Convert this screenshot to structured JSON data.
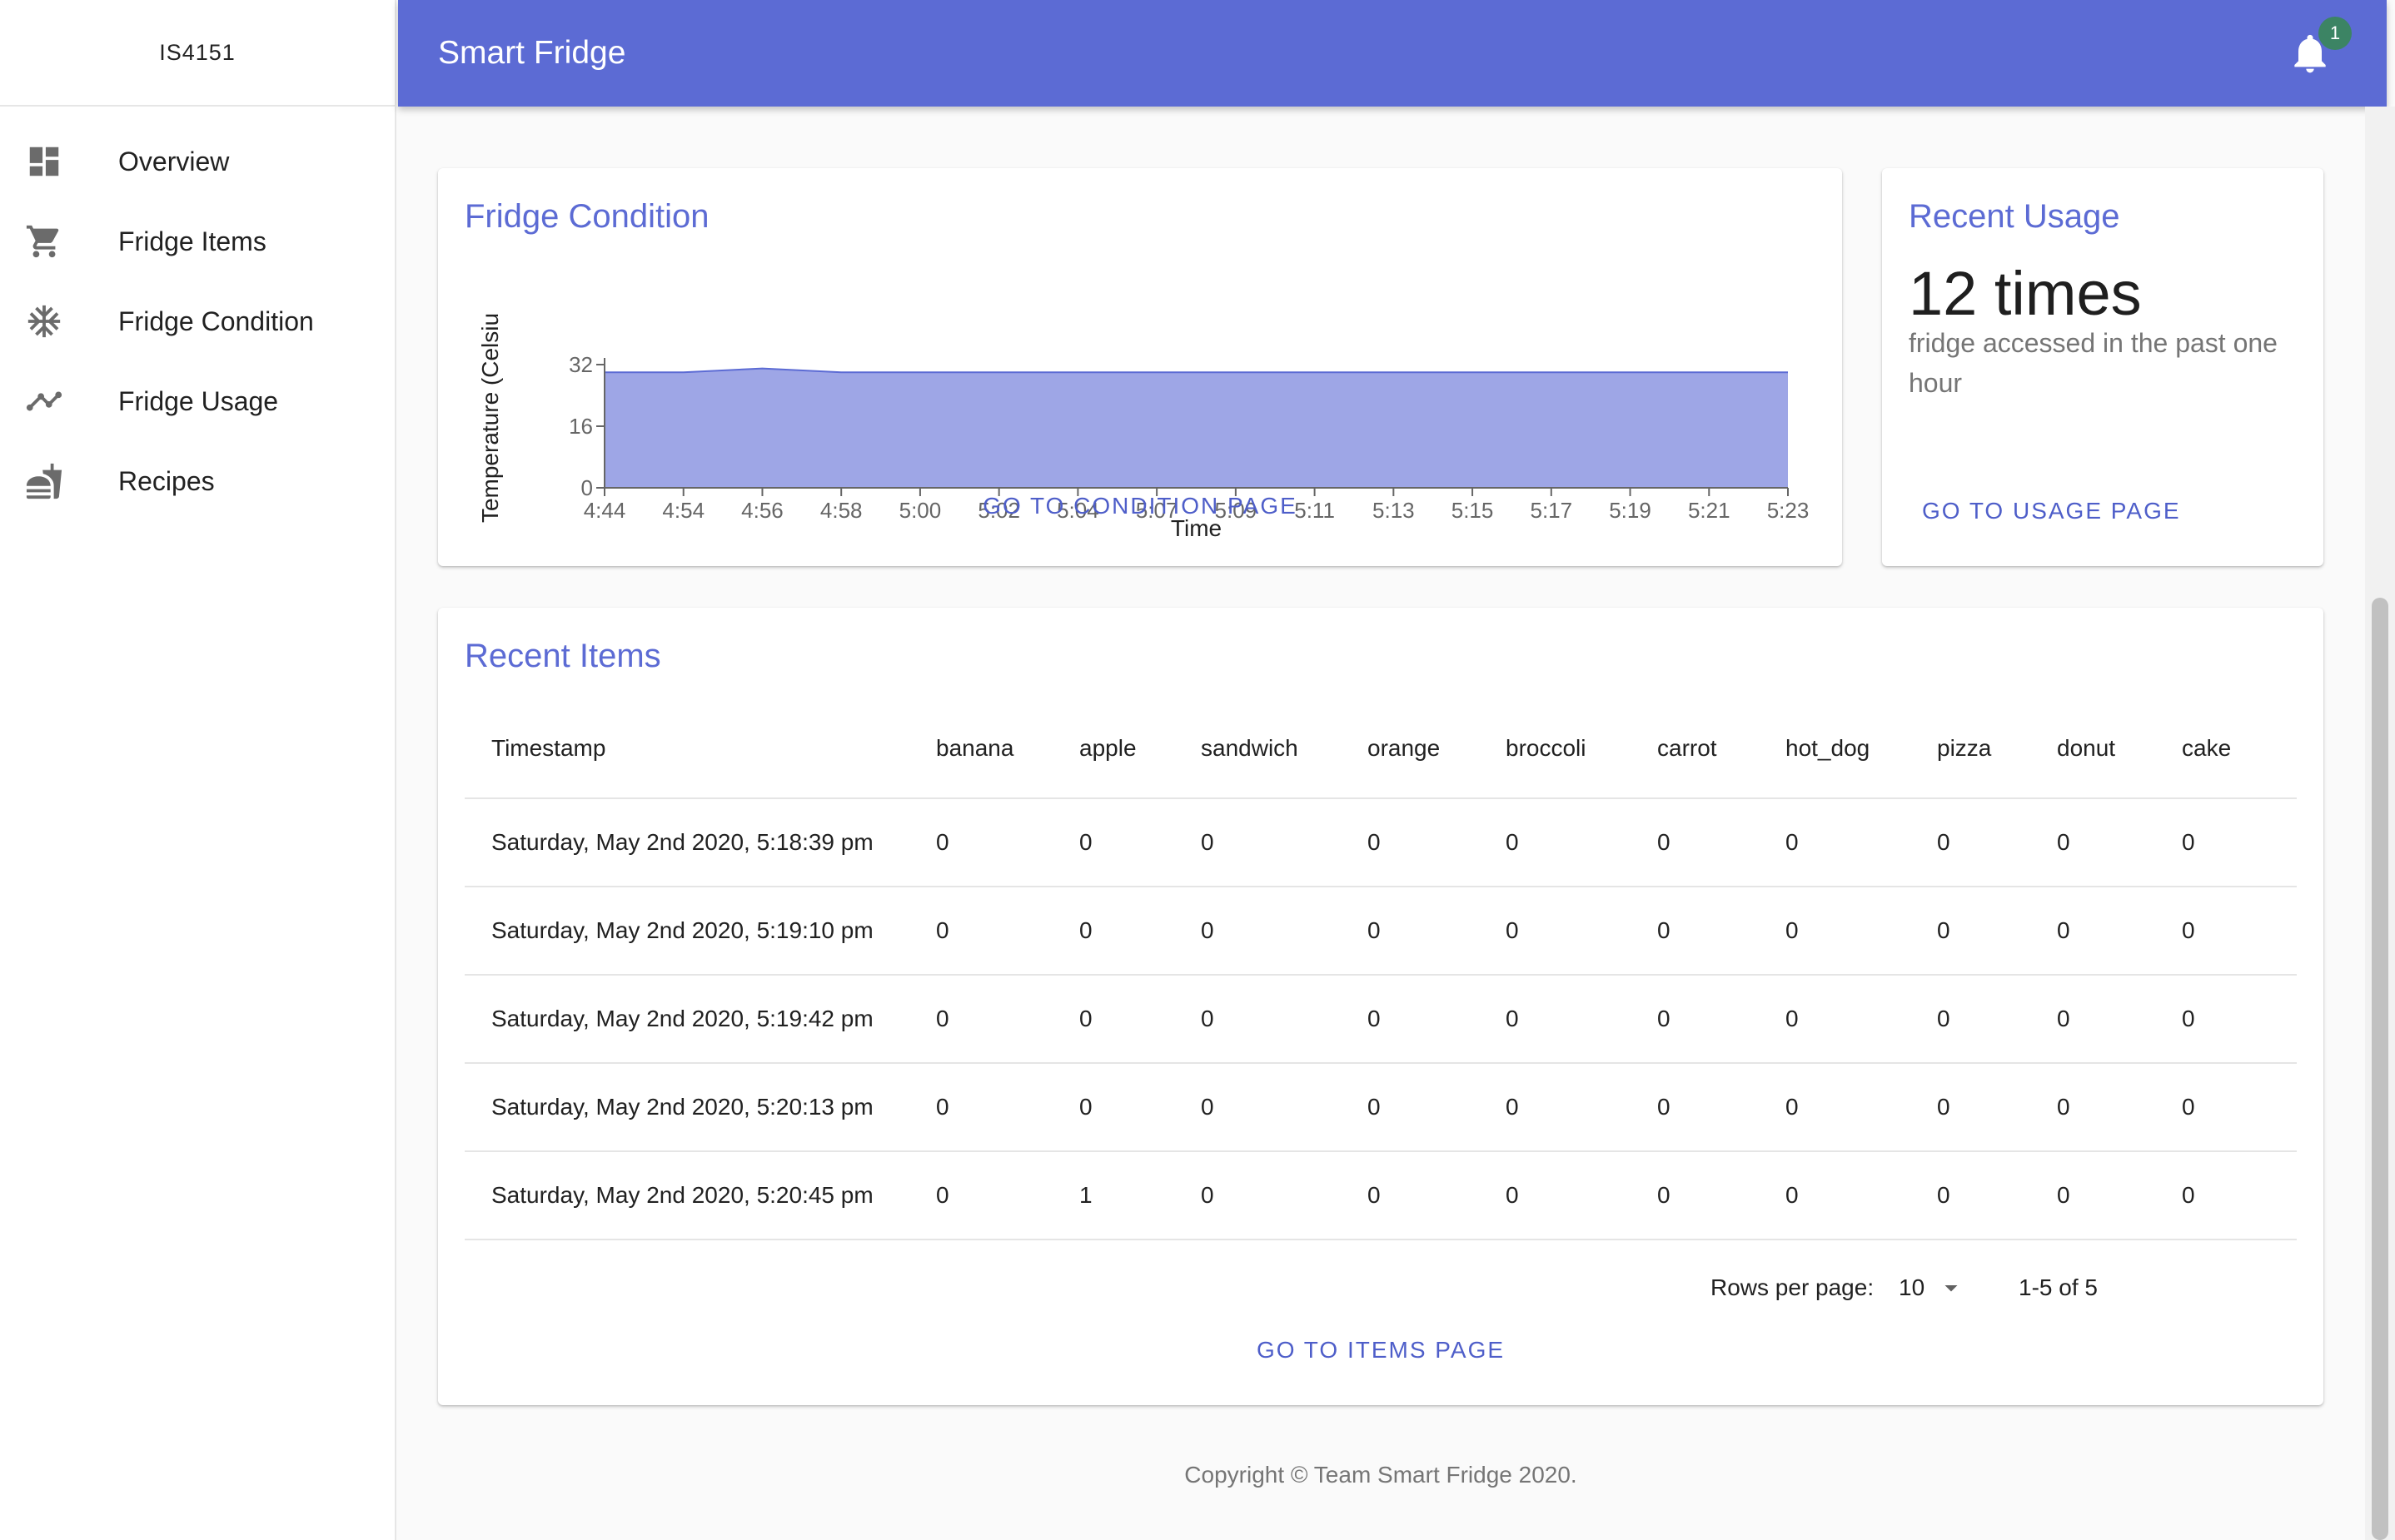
{
  "sidebar": {
    "brand": "IS4151",
    "items": [
      {
        "label": "Overview",
        "icon": "dashboard-icon"
      },
      {
        "label": "Fridge Items",
        "icon": "cart-icon"
      },
      {
        "label": "Fridge Condition",
        "icon": "snowflake-icon"
      },
      {
        "label": "Fridge Usage",
        "icon": "trending-icon"
      },
      {
        "label": "Recipes",
        "icon": "food-icon"
      }
    ]
  },
  "appbar": {
    "title": "Smart Fridge",
    "notification_count": "1"
  },
  "condition_card": {
    "title": "Fridge Condition",
    "link": "GO TO CONDITION PAGE"
  },
  "chart_data": {
    "type": "area",
    "xlabel": "Time",
    "ylabel": "Temperature (Celsiu",
    "ylim": [
      0,
      32
    ],
    "yticks": [
      "0",
      "16",
      "32"
    ],
    "x": [
      "4:44",
      "4:54",
      "4:56",
      "4:58",
      "5:00",
      "5:02",
      "5:04",
      "5:07",
      "5:09",
      "5:11",
      "5:13",
      "5:15",
      "5:17",
      "5:19",
      "5:21",
      "5:23"
    ],
    "series": [
      {
        "values": [
          30,
          30,
          31,
          30,
          30,
          30,
          30,
          30,
          30,
          30,
          30,
          30,
          30,
          30,
          30,
          30
        ]
      }
    ],
    "fill_color": "#9ea6e6",
    "line_color": "#5c6bd4"
  },
  "usage_card": {
    "title": "Recent Usage",
    "count_text": "12 times",
    "description": "fridge accessed in the past one hour",
    "link": "GO TO USAGE PAGE"
  },
  "items_card": {
    "title": "Recent Items",
    "columns": [
      "Timestamp",
      "banana",
      "apple",
      "sandwich",
      "orange",
      "broccoli",
      "carrot",
      "hot_dog",
      "pizza",
      "donut",
      "cake"
    ],
    "rows": [
      [
        "Saturday, May 2nd 2020, 5:18:39 pm",
        "0",
        "0",
        "0",
        "0",
        "0",
        "0",
        "0",
        "0",
        "0",
        "0"
      ],
      [
        "Saturday, May 2nd 2020, 5:19:10 pm",
        "0",
        "0",
        "0",
        "0",
        "0",
        "0",
        "0",
        "0",
        "0",
        "0"
      ],
      [
        "Saturday, May 2nd 2020, 5:19:42 pm",
        "0",
        "0",
        "0",
        "0",
        "0",
        "0",
        "0",
        "0",
        "0",
        "0"
      ],
      [
        "Saturday, May 2nd 2020, 5:20:13 pm",
        "0",
        "0",
        "0",
        "0",
        "0",
        "0",
        "0",
        "0",
        "0",
        "0"
      ],
      [
        "Saturday, May 2nd 2020, 5:20:45 pm",
        "0",
        "1",
        "0",
        "0",
        "0",
        "0",
        "0",
        "0",
        "0",
        "0"
      ]
    ],
    "rows_per_page_label": "Rows per page:",
    "rows_per_page_value": "10",
    "range_text": "1-5 of 5",
    "link": "GO TO ITEMS PAGE"
  },
  "footer": {
    "copyright": "Copyright © Team Smart Fridge 2020."
  }
}
